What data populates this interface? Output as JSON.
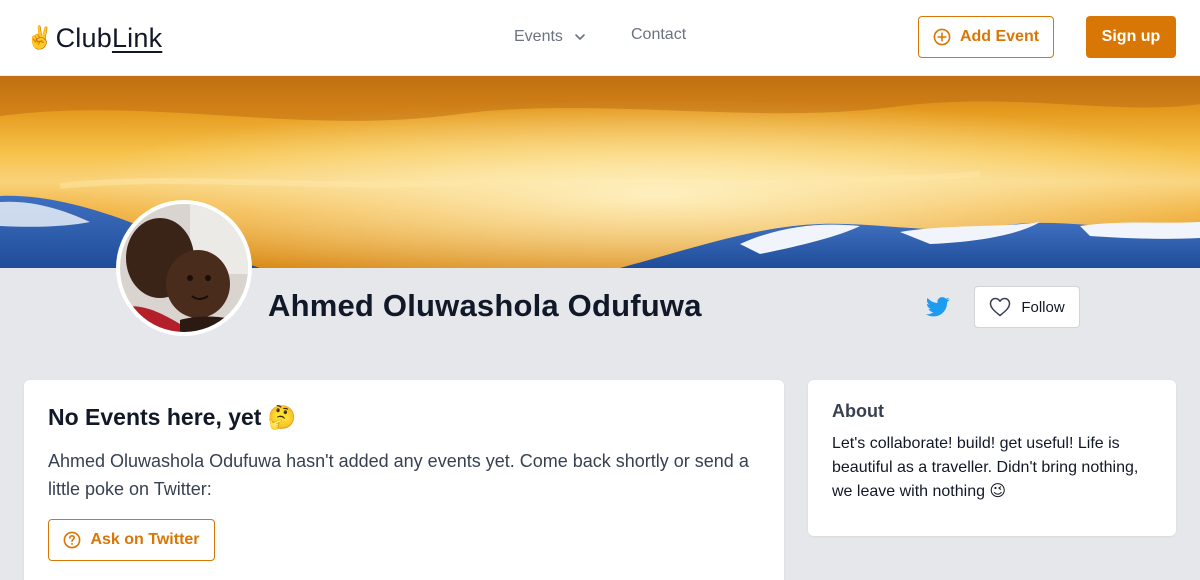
{
  "header": {
    "logo_emoji": "✌️",
    "logo_text_a": "Club",
    "logo_text_b": "Link",
    "nav": {
      "events_label": "Events",
      "contact_label": "Contact"
    },
    "add_event_label": "Add Event",
    "signup_label": "Sign up"
  },
  "profile": {
    "name": "Ahmed Oluwashola Odufuwa",
    "follow_label": "Follow",
    "twitter_icon": "twitter-icon",
    "heart_icon": "heart-icon"
  },
  "events_section": {
    "title": "No Events here, yet 🤔",
    "description": "Ahmed Oluwashola Odufuwa hasn't added any events yet. Come back shortly or send a little poke on Twitter:",
    "ask_label": "Ask on Twitter"
  },
  "about_section": {
    "title": "About",
    "text": "Let's collaborate! build! get useful! Life is beautiful as a traveller. Didn't bring nothing, we leave with nothing 😉"
  },
  "colors": {
    "accent": "#d97706",
    "twitter": "#1d9bf0",
    "page_bg": "#e5e7eb"
  }
}
